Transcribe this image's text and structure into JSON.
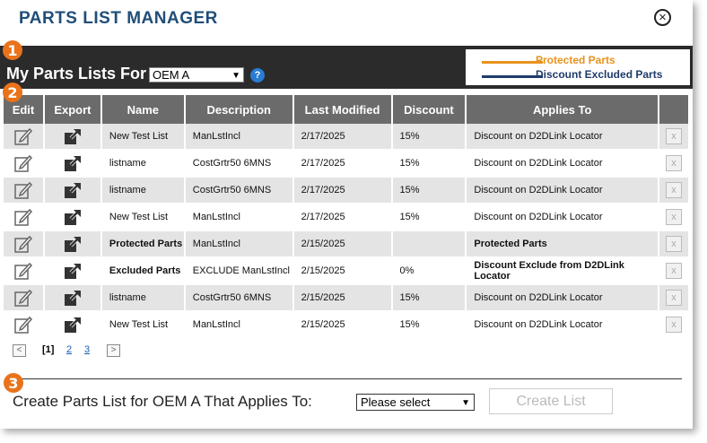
{
  "header": {
    "title": "PARTS LIST MANAGER",
    "close_symbol": "×"
  },
  "badges": {
    "b1": "1",
    "b2": "2",
    "b3": "3"
  },
  "toolbar": {
    "my_lists_label": "My Parts Lists For",
    "oem_value": "OEM A",
    "help_symbol": "?"
  },
  "legend": {
    "protected_label": "Protected Parts",
    "protected_color": "#e8921e",
    "excluded_label": "Discount Excluded Parts",
    "excluded_color": "#1f3b6b"
  },
  "table": {
    "columns": [
      "Edit",
      "Export",
      "Name",
      "Description",
      "Last Modified",
      "Discount",
      "Applies To",
      ""
    ],
    "rows": [
      {
        "name": "New Test List",
        "description": "ManLstIncl",
        "modified": "2/17/2025",
        "discount": "15%",
        "applies": "Discount on D2DLink Locator",
        "style": ""
      },
      {
        "name": "listname",
        "description": "CostGrtr50 6MNS",
        "modified": "2/17/2025",
        "discount": "15%",
        "applies": "Discount on D2DLink Locator",
        "style": ""
      },
      {
        "name": "listname",
        "description": "CostGrtr50 6MNS",
        "modified": "2/17/2025",
        "discount": "15%",
        "applies": "Discount on D2DLink Locator",
        "style": ""
      },
      {
        "name": "New Test List",
        "description": "ManLstIncl",
        "modified": "2/17/2025",
        "discount": "15%",
        "applies": "Discount on D2DLink Locator",
        "style": ""
      },
      {
        "name": "Protected Parts",
        "description": "ManLstIncl",
        "modified": "2/15/2025",
        "discount": "",
        "applies": "Protected Parts",
        "style": "protected"
      },
      {
        "name": "Excluded Parts",
        "description": "EXCLUDE ManLstIncl",
        "modified": "2/15/2025",
        "discount": "0%",
        "applies": "Discount Exclude from D2DLink Locator",
        "style": "excluded"
      },
      {
        "name": "listname",
        "description": "CostGrtr50 6MNS",
        "modified": "2/15/2025",
        "discount": "15%",
        "applies": "Discount on D2DLink Locator",
        "style": ""
      },
      {
        "name": "New Test List",
        "description": "ManLstIncl",
        "modified": "2/15/2025",
        "discount": "15%",
        "applies": "Discount on D2DLink Locator",
        "style": ""
      }
    ],
    "delete_symbol": "x"
  },
  "pager": {
    "prev": "<",
    "current": "[1]",
    "page2": "2",
    "page3": "3",
    "next": ">"
  },
  "create": {
    "label": "Create Parts List for OEM A That Applies To:",
    "select_value": "Please select",
    "button_label": "Create List"
  }
}
